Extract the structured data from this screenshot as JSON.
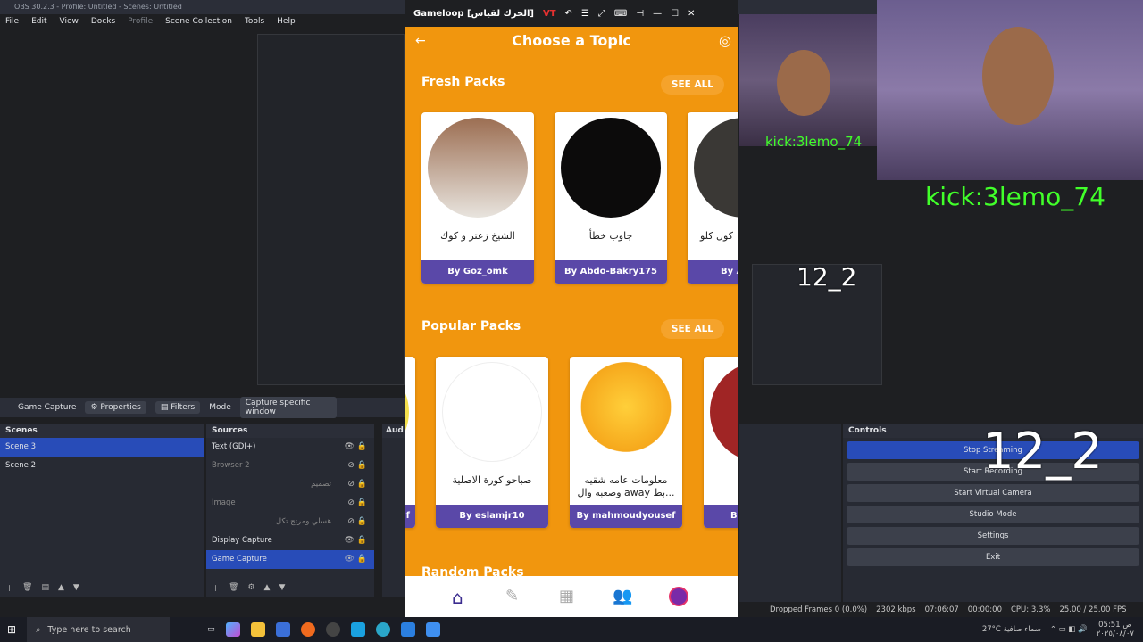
{
  "obs": {
    "title": "OBS 30.2.3 - Profile: Untitled - Scenes: Untitled",
    "menu": [
      "File",
      "Edit",
      "View",
      "Docks",
      "Profile",
      "Scene Collection",
      "Tools",
      "Help"
    ],
    "source_bar": {
      "name": "Game Capture",
      "properties": "Properties",
      "filters": "Filters",
      "mode_label": "Mode",
      "mode_value": "Capture specific window"
    },
    "scenes": {
      "title": "Scenes",
      "items": [
        "Scene 3",
        "Scene 2"
      ],
      "selected": 0
    },
    "sources": {
      "title": "Sources",
      "items": [
        "Text (GDI+)",
        "Browser 2",
        "تصميم",
        "Image",
        "هسلي ومرتح تكل",
        "Display Capture",
        "Game Capture"
      ],
      "selected": 6
    },
    "audio_title": "Aud",
    "controls": {
      "title": "Controls",
      "buttons": [
        "Stop Streaming",
        "Start Recording",
        "Start Virtual Camera",
        "Studio Mode",
        "Settings",
        "Exit"
      ]
    },
    "status": {
      "dropped": "Dropped Frames 0 (0.0%)",
      "kbps": "2302 kbps",
      "stream_time": "07:06:07",
      "rec_time": "00:00:00",
      "cpu": "CPU: 3.3%",
      "fps": "25.00 / 25.00 FPS"
    }
  },
  "overlay": {
    "kick_small": "kick:3lemo_74",
    "kick_large": "kick:3lemo_74",
    "num_small": "12_2",
    "num_large": "12_2"
  },
  "gameloop": {
    "title": "Gameloop [الحرك لقياس]",
    "vt": "VT"
  },
  "app": {
    "title": "Choose a Topic",
    "fresh": {
      "title": "Fresh Packs",
      "see_all": "SEE ALL",
      "cards": [
        {
          "name": "الشيخ زعتر و كوك",
          "by": "By Goz_omk"
        },
        {
          "name": "جاوب خطأ",
          "by": "By Abdo-Bakry175"
        },
        {
          "name": "كول كلو",
          "by": "By A"
        }
      ]
    },
    "popular": {
      "title": "Popular Packs",
      "see_all": "SEE ALL",
      "cards": [
        {
          "name": "صباحو كورة الاصلية",
          "by": "By eslamjr10"
        },
        {
          "name": "معلومات عامه شقيه وصعبه وال away بط...",
          "by": "By mahmoudyousef"
        },
        {
          "name": "",
          "by": "B"
        }
      ],
      "left_partial_by": "f"
    },
    "random_title": "Random Packs"
  },
  "taskbar": {
    "search_placeholder": "Type here to search",
    "weather": "27°C سماء صافية",
    "time": "05:51 ص",
    "date": "٢٠٢٥/٠٨/٠٧"
  }
}
